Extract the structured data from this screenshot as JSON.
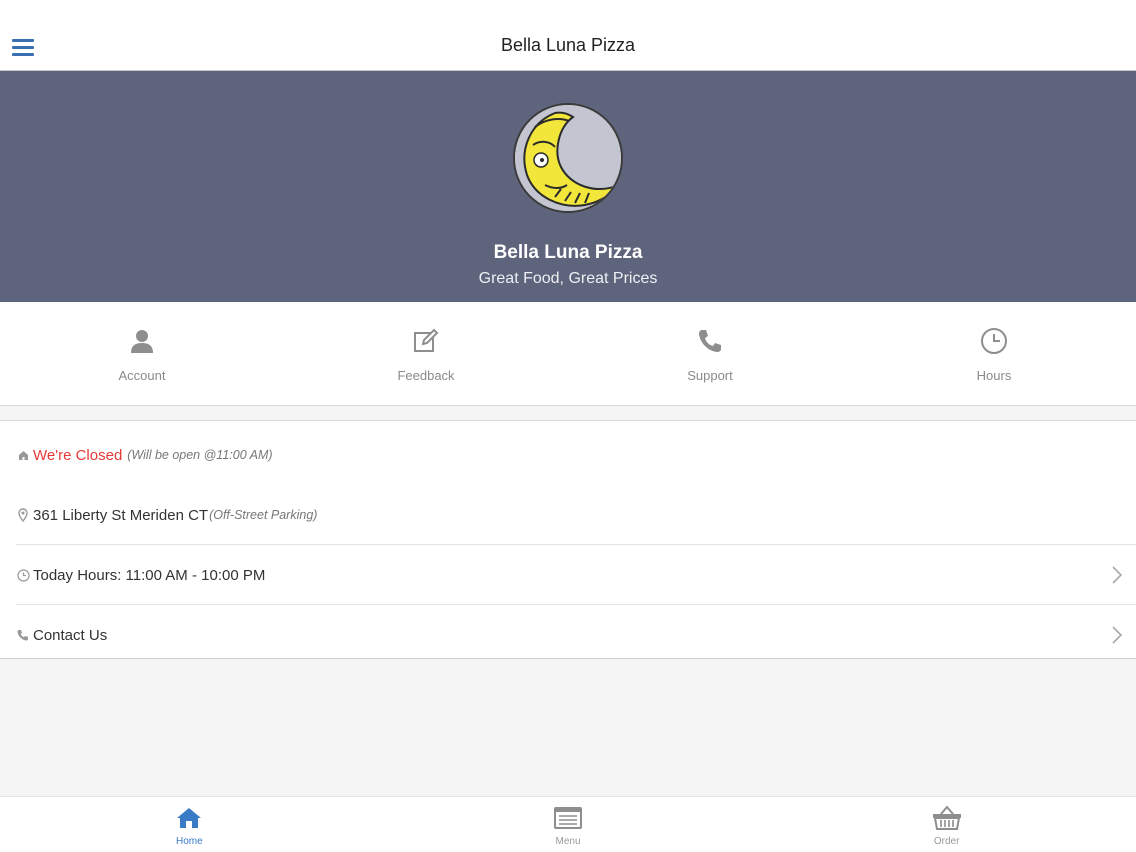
{
  "header": {
    "title": "Bella Luna Pizza",
    "menu_icon": "hamburger-menu-icon"
  },
  "hero": {
    "name": "Bella Luna Pizza",
    "tagline": "Great Food, Great Prices",
    "logo": "moon-logo"
  },
  "actions": [
    {
      "label": "Account",
      "icon": "user-icon"
    },
    {
      "label": "Feedback",
      "icon": "edit-icon"
    },
    {
      "label": "Support",
      "icon": "phone-icon"
    },
    {
      "label": "Hours",
      "icon": "clock-icon"
    }
  ],
  "info": {
    "status": {
      "label": "We're Closed",
      "note": "(Will be open @11:00 AM)",
      "color": "#e53935"
    },
    "address": {
      "text": "361 Liberty St Meriden CT",
      "note": "(Off-Street Parking)"
    },
    "hours": {
      "text": "Today Hours: 11:00 AM - 10:00 PM"
    },
    "contact": {
      "text": "Contact Us"
    }
  },
  "tabs": [
    {
      "label": "Home",
      "icon": "home-icon",
      "active": true
    },
    {
      "label": "Menu",
      "icon": "menu-list-icon",
      "active": false
    },
    {
      "label": "Order",
      "icon": "basket-icon",
      "active": false
    }
  ],
  "colors": {
    "accent": "#3a7bc8",
    "hero_bg": "#5e647b",
    "closed": "#e53935"
  }
}
